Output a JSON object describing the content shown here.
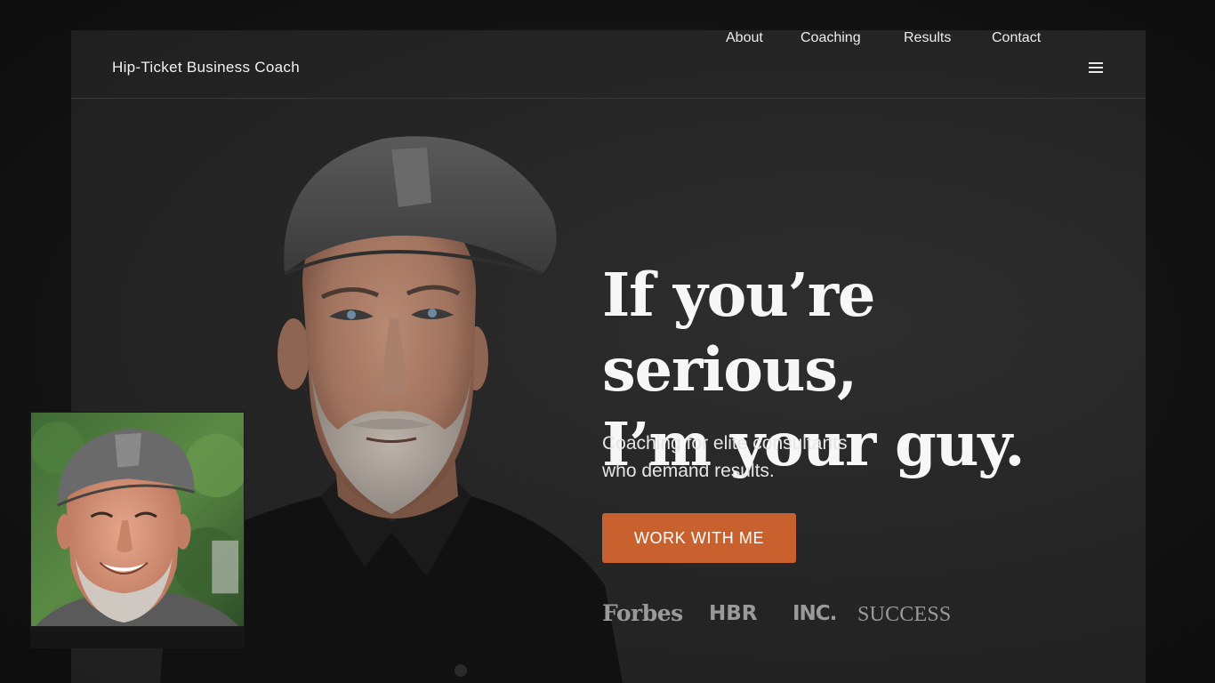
{
  "header": {
    "brand": "Hip-Ticket Business Coach",
    "nav": [
      {
        "label": "About"
      },
      {
        "label": "Coaching"
      },
      {
        "label": "Results"
      },
      {
        "label": "Contact"
      }
    ],
    "menu_icon": "hamburger-menu-icon"
  },
  "hero": {
    "headline_line1": "If you’re serious,",
    "headline_line2": "I’m your guy.",
    "subhead_line1": "Coaching for elite consultants",
    "subhead_line2": "who demand results.",
    "cta_label": "WORK WITH ME"
  },
  "press": {
    "logos": [
      {
        "name": "Forbes"
      },
      {
        "name": "HBR"
      },
      {
        "name": "INC."
      },
      {
        "name": "SUCCESS"
      }
    ]
  },
  "colors": {
    "accent": "#c8612d",
    "background": "#262626"
  }
}
